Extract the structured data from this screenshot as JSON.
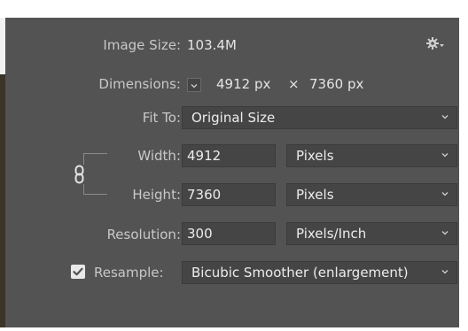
{
  "image_size": {
    "label": "Image Size:",
    "value": "103.4M"
  },
  "dimensions": {
    "label": "Dimensions:",
    "width": "4912 px",
    "times": "×",
    "height": "7360 px"
  },
  "fit_to": {
    "label": "Fit To:",
    "value": "Original Size"
  },
  "width": {
    "label": "Width:",
    "value": "4912",
    "unit": "Pixels"
  },
  "height": {
    "label": "Height:",
    "value": "7360",
    "unit": "Pixels"
  },
  "resolution": {
    "label": "Resolution:",
    "value": "300",
    "unit": "Pixels/Inch"
  },
  "resample": {
    "label": "Resample:",
    "checked": true,
    "value": "Bicubic Smoother (enlargement)"
  },
  "icons": {
    "settings": "gear-icon",
    "link": "chain-link-icon",
    "dropdown": "chevron-down-icon",
    "check": "check-icon"
  },
  "colors": {
    "panel": "#535353",
    "field": "#454545",
    "text": "#d6d6d6"
  }
}
